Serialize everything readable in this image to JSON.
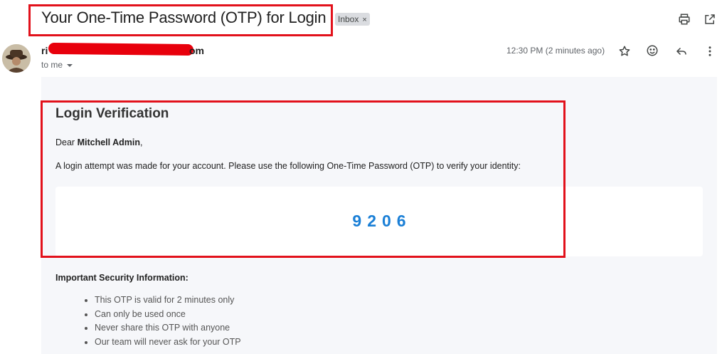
{
  "header": {
    "subject": "Your One-Time Password (OTP) for Login",
    "label_chip": "Inbox",
    "label_remove": "×",
    "icons": {
      "print": "print-icon",
      "popout": "open-in-new-icon"
    }
  },
  "message": {
    "sender_prefix": "ri",
    "sender_suffix": "om",
    "to_line": "to me",
    "timestamp": "12:30 PM (2 minutes ago)",
    "actions": [
      "star-icon",
      "emoji-icon",
      "reply-icon",
      "more-vert-icon"
    ]
  },
  "email": {
    "heading": "Login Verification",
    "greeting_prefix": "Dear ",
    "recipient_name": "Mitchell Admin",
    "greeting_suffix": ",",
    "intro": "A login attempt was made for your account. Please use the following One-Time Password (OTP) to verify your identity:",
    "otp": "9206",
    "security_title": "Important Security Information:",
    "security_items": [
      "This OTP is valid for 2 minutes only",
      "Can only be used once",
      "Never share this OTP with anyone",
      "Our team will never ask for your OTP"
    ]
  },
  "colors": {
    "highlight": "#e2111b",
    "otp": "#1a7fd6",
    "email_background": "#f6f7fa"
  }
}
